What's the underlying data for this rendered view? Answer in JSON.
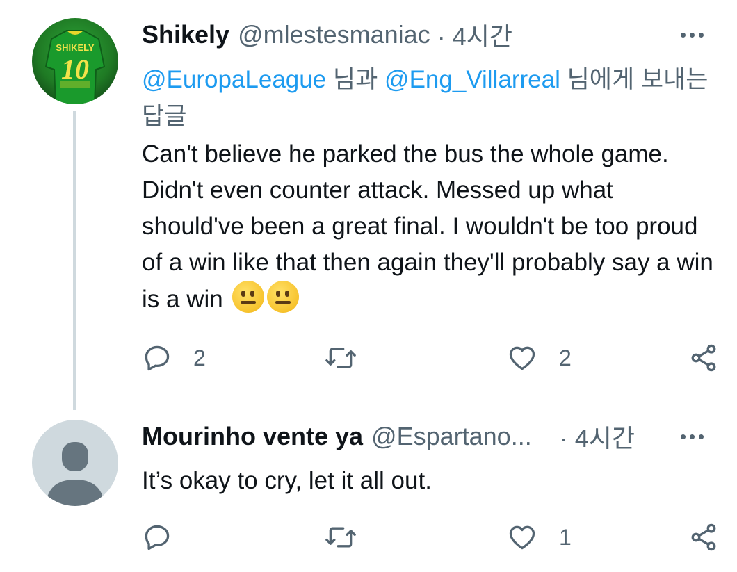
{
  "tweets": [
    {
      "name": "Shikely",
      "handle": "@mlestesmaniac",
      "time": "· 4시간",
      "avatar_text": "SHIKELY",
      "avatar_number": "10",
      "reply_mention_1": "@EuropaLeague",
      "reply_conn_1": " 님과 ",
      "reply_mention_2": "@Eng_Villarreal",
      "reply_conn_2": " 님에게 보내는 답글",
      "text": "Can't believe he parked the bus the whole game. Didn't even counter attack. Messed up what should've been a great final. I wouldn't be too proud of a win like that then again they'll probably say a win is a win",
      "emojis": [
        "neutral-face",
        "neutral-face"
      ],
      "replies": "2",
      "retweets": "",
      "likes": "2"
    },
    {
      "name": "Mourinho vente ya",
      "handle": "@Espartano...",
      "time": "· 4시간",
      "text": "It’s okay to cry, let it all out.",
      "replies": "",
      "retweets": "",
      "likes": "1"
    }
  ],
  "colors": {
    "accent": "#1d9bf0",
    "secondary_text": "#536471",
    "thread_line": "#cfd9de",
    "avatar_default": "#cfd9de",
    "avatar_jersey": "#1f8f2a"
  },
  "icons": [
    "more-icon",
    "reply-icon",
    "retweet-icon",
    "like-icon",
    "share-icon",
    "neutral-face-emoji",
    "default-avatar-icon"
  ]
}
